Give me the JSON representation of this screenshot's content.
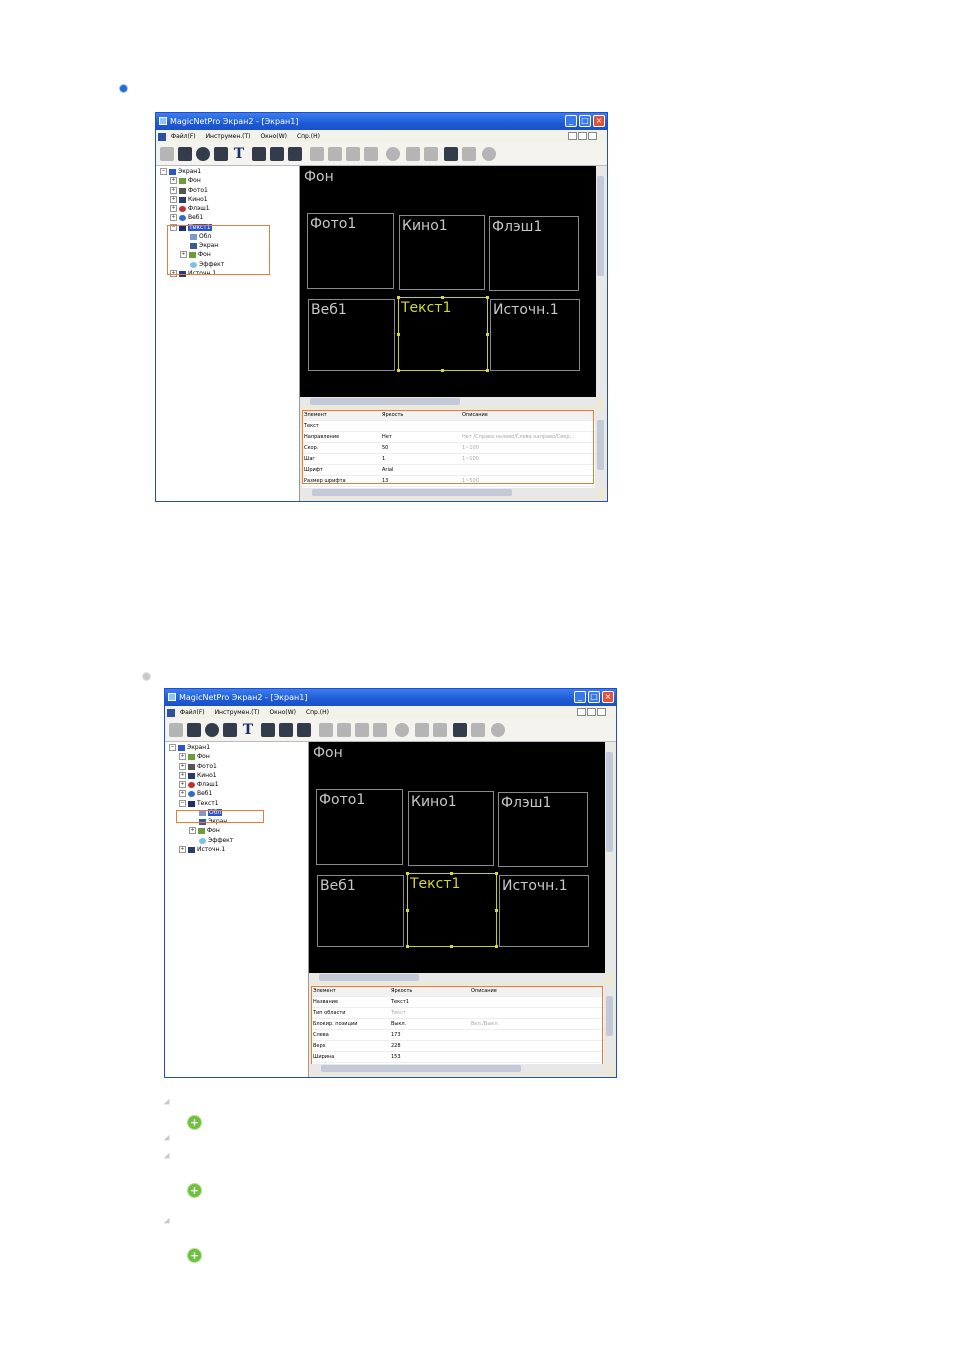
{
  "colors": {
    "titlebar": "#1d5bd6",
    "highlight": "#e97c3c",
    "active_box": "#c9cc1e",
    "plus_bullet": "#6cc23d"
  },
  "window": {
    "title": "MagicNetPro Экран2 - [Экран1]",
    "menu": [
      "Файл(F)",
      "Инструмен.(T)",
      "Окно(W)",
      "Спр.(H)"
    ]
  },
  "canvas": {
    "background_label": "Фон",
    "boxes": [
      "Фото1",
      "Кино1",
      "Флэш1",
      "Веб1",
      "Текст1",
      "Источн.1"
    ]
  },
  "tree": {
    "items": [
      "Экран1",
      "Фон",
      "Фото1",
      "Кино1",
      "Флэш1",
      "Веб1",
      "Текст1",
      "Обл",
      "Экран",
      "Фон",
      "Эффект",
      "Источн.1"
    ]
  },
  "screenshot1": {
    "props_header": [
      "Элемент",
      "Яркость",
      "Описание"
    ],
    "props_rows": [
      [
        "Текст",
        "",
        ""
      ],
      [
        "Направление",
        "Нет",
        "Нет /Справа налево/Слева направо/Свер..."
      ],
      [
        "Скор.",
        "50",
        "1~100"
      ],
      [
        "Шаг",
        "1",
        "1~100"
      ],
      [
        "Шрифт",
        "Arial",
        ""
      ],
      [
        "Размер шрифта",
        "13",
        "1~500"
      ]
    ]
  },
  "screenshot2": {
    "props_header": [
      "Элемент",
      "Яркость",
      "Описание"
    ],
    "props_rows": [
      [
        "Название",
        "Текст1",
        ""
      ],
      [
        "Тип области",
        "Текст",
        ""
      ],
      [
        "Блокир. позиции",
        "Выкл.",
        "Вкл./Выкл."
      ],
      [
        "Слева",
        "173",
        ""
      ],
      [
        "Верх",
        "228",
        ""
      ],
      [
        "Ширина",
        "153",
        ""
      ]
    ]
  }
}
